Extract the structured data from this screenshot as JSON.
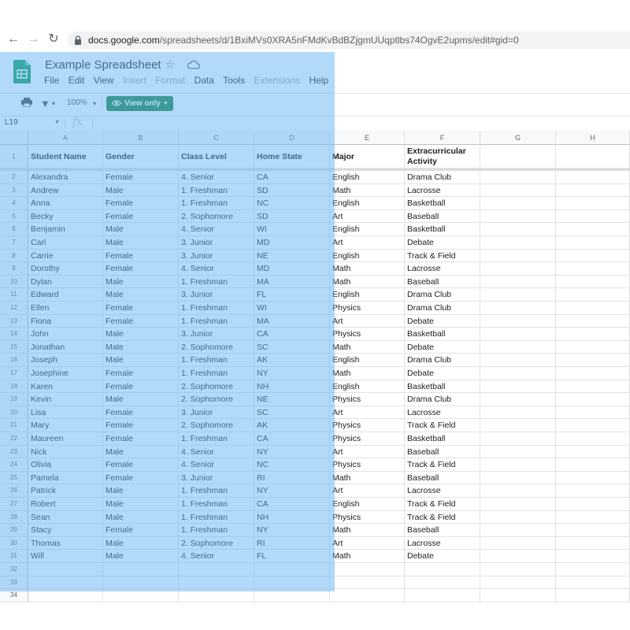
{
  "browser": {
    "url_domain": "docs.google.com",
    "url_path": "/spreadsheets/d/1BxiMVs0XRA5nFMdKvBdBZjgmUUqptlbs74OgvE2upms/edit#gid=0",
    "back_icon": "arrow-left-icon",
    "forward_icon": "arrow-right-icon",
    "reload_icon": "reload-icon",
    "lock_icon": "lock-icon"
  },
  "app": {
    "title": "Example Spreadsheet",
    "star_glyph": "☆",
    "menu": [
      "File",
      "Edit",
      "View",
      "Insert",
      "Format",
      "Data",
      "Tools",
      "Extensions",
      "Help"
    ],
    "menu_disabled": [
      "Insert",
      "Format",
      "Extensions"
    ]
  },
  "toolbar": {
    "zoom": "100%",
    "view_only_label": "View only"
  },
  "formula_bar": {
    "cell_ref": "L19",
    "fx_label": "fx"
  },
  "columns": [
    "A",
    "B",
    "C",
    "D",
    "E",
    "F",
    "G",
    "H"
  ],
  "headers": [
    "Student Name",
    "Gender",
    "Class Level",
    "Home State",
    "Major",
    "Extracurricular Activity"
  ],
  "rows": [
    [
      "Alexandra",
      "Female",
      "4. Senior",
      "CA",
      "English",
      "Drama Club"
    ],
    [
      "Andrew",
      "Male",
      "1. Freshman",
      "SD",
      "Math",
      "Lacrosse"
    ],
    [
      "Anna",
      "Female",
      "1. Freshman",
      "NC",
      "English",
      "Basketball"
    ],
    [
      "Becky",
      "Female",
      "2. Sophomore",
      "SD",
      "Art",
      "Baseball"
    ],
    [
      "Benjamin",
      "Male",
      "4. Senior",
      "WI",
      "English",
      "Basketball"
    ],
    [
      "Carl",
      "Male",
      "3. Junior",
      "MD",
      "Art",
      "Debate"
    ],
    [
      "Carrie",
      "Female",
      "3. Junior",
      "NE",
      "English",
      "Track & Field"
    ],
    [
      "Dorothy",
      "Female",
      "4. Senior",
      "MD",
      "Math",
      "Lacrosse"
    ],
    [
      "Dylan",
      "Male",
      "1. Freshman",
      "MA",
      "Math",
      "Baseball"
    ],
    [
      "Edward",
      "Male",
      "3. Junior",
      "FL",
      "English",
      "Drama Club"
    ],
    [
      "Ellen",
      "Female",
      "1. Freshman",
      "WI",
      "Physics",
      "Drama Club"
    ],
    [
      "Fiona",
      "Female",
      "1. Freshman",
      "MA",
      "Art",
      "Debate"
    ],
    [
      "John",
      "Male",
      "3. Junior",
      "CA",
      "Physics",
      "Basketball"
    ],
    [
      "Jonathan",
      "Male",
      "2. Sophomore",
      "SC",
      "Math",
      "Debate"
    ],
    [
      "Joseph",
      "Male",
      "1. Freshman",
      "AK",
      "English",
      "Drama Club"
    ],
    [
      "Josephine",
      "Female",
      "1. Freshman",
      "NY",
      "Math",
      "Debate"
    ],
    [
      "Karen",
      "Female",
      "2. Sophomore",
      "NH",
      "English",
      "Basketball"
    ],
    [
      "Kevin",
      "Male",
      "2. Sophomore",
      "NE",
      "Physics",
      "Drama Club"
    ],
    [
      "Lisa",
      "Female",
      "3. Junior",
      "SC",
      "Art",
      "Lacrosse"
    ],
    [
      "Mary",
      "Female",
      "2. Sophomore",
      "AK",
      "Physics",
      "Track & Field"
    ],
    [
      "Maureen",
      "Female",
      "1. Freshman",
      "CA",
      "Physics",
      "Basketball"
    ],
    [
      "Nick",
      "Male",
      "4. Senior",
      "NY",
      "Art",
      "Baseball"
    ],
    [
      "Olivia",
      "Female",
      "4. Senior",
      "NC",
      "Physics",
      "Track & Field"
    ],
    [
      "Pamela",
      "Female",
      "3. Junior",
      "RI",
      "Math",
      "Baseball"
    ],
    [
      "Patrick",
      "Male",
      "1. Freshman",
      "NY",
      "Art",
      "Lacrosse"
    ],
    [
      "Robert",
      "Male",
      "1. Freshman",
      "CA",
      "English",
      "Track & Field"
    ],
    [
      "Sean",
      "Male",
      "1. Freshman",
      "NH",
      "Physics",
      "Track & Field"
    ],
    [
      "Stacy",
      "Female",
      "1. Freshman",
      "NY",
      "Math",
      "Baseball"
    ],
    [
      "Thomas",
      "Male",
      "2. Sophomore",
      "RI",
      "Art",
      "Lacrosse"
    ],
    [
      "Will",
      "Male",
      "4. Senior",
      "FL",
      "Math",
      "Debate"
    ]
  ],
  "extra_row_numbers": [
    "32",
    "33",
    "34"
  ],
  "colors": {
    "brand_green": "#188038",
    "sheets_logo": "#0f9d58",
    "selection_overlay": "#64b4f5"
  }
}
